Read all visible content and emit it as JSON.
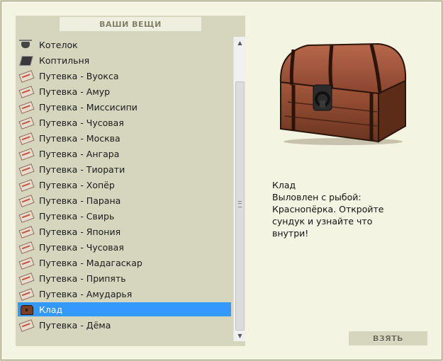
{
  "panel": {
    "title": "ВАШИ ВЕЩИ"
  },
  "items": [
    {
      "label": "Котелок",
      "icon": "pot-icon"
    },
    {
      "label": "Коптильня",
      "icon": "smoker-icon"
    },
    {
      "label": "Путевка - Вуокса",
      "icon": "ticket-icon"
    },
    {
      "label": "Путевка - Амур",
      "icon": "ticket-icon"
    },
    {
      "label": "Путевка - Миссисипи",
      "icon": "ticket-icon"
    },
    {
      "label": "Путевка - Чусовая",
      "icon": "ticket-icon"
    },
    {
      "label": "Путевка - Москва",
      "icon": "ticket-icon"
    },
    {
      "label": "Путевка - Ангара",
      "icon": "ticket-icon"
    },
    {
      "label": "Путевка - Тиорати",
      "icon": "ticket-icon"
    },
    {
      "label": "Путевка - Хопёр",
      "icon": "ticket-icon"
    },
    {
      "label": "Путевка - Парана",
      "icon": "ticket-icon"
    },
    {
      "label": "Путевка - Свирь",
      "icon": "ticket-icon"
    },
    {
      "label": "Путевка - Япония",
      "icon": "ticket-icon"
    },
    {
      "label": "Путевка - Чусовая",
      "icon": "ticket-icon"
    },
    {
      "label": "Путевка - Мадагаскар",
      "icon": "ticket-icon"
    },
    {
      "label": "Путевка - Припять",
      "icon": "ticket-icon"
    },
    {
      "label": "Путевка - Амударья",
      "icon": "ticket-icon"
    },
    {
      "label": "Клад",
      "icon": "chest-icon",
      "selected": true
    },
    {
      "label": "Путевка - Дёма",
      "icon": "ticket-icon"
    }
  ],
  "details": {
    "image_icon": "treasure-chest-image",
    "lines": [
      "Клад",
      "Выловлен с рыбой:",
      "Краснопёрка. Откройте",
      "сундук и узнайте что",
      "внутри!"
    ]
  },
  "actions": {
    "take_label": "ВЗЯТЬ"
  },
  "colors": {
    "selection": "#3399ff",
    "panel_bg": "#d6d6bf",
    "page_bg": "#f4f4e2"
  }
}
